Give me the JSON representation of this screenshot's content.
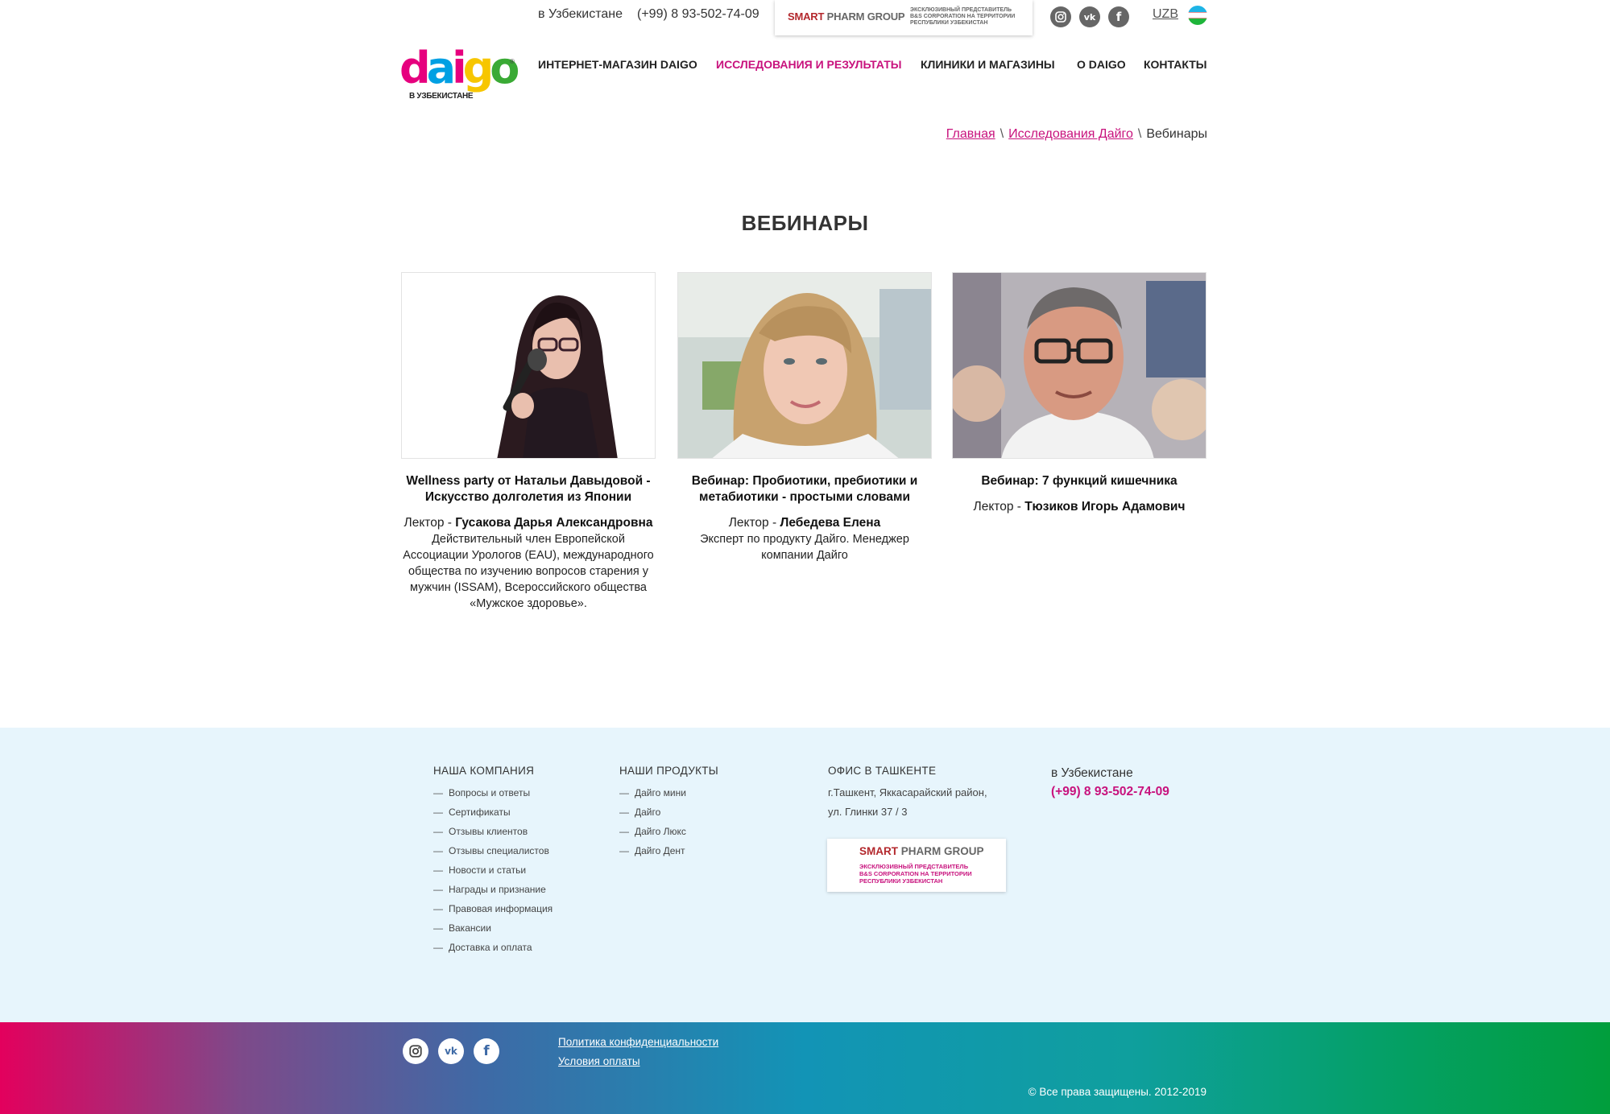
{
  "topbar": {
    "region": "в Узбекистане",
    "phone": "(+99) 8 93-502-74-09",
    "smart_red": "SMART",
    "smart_gray": "PHARM GROUP",
    "smart_sub_1": "ЭКСКЛЮЗИВНЫЙ ПРЕДСТАВИТЕЛЬ",
    "smart_sub_2": "B&S CORPORATION НА ТЕРРИТОРИИ",
    "smart_sub_3": "РЕСПУБЛИКИ УЗБЕКИСТАН",
    "social_icons": [
      "instagram-icon",
      "vk-icon",
      "facebook-icon"
    ],
    "lang": "UZB"
  },
  "logo": {
    "word": "daigo",
    "sub": "В УЗБЕКИСТАНЕ",
    "reg": "®",
    "colors": [
      "#e6007e",
      "#00a0e3",
      "#ffe600",
      "#f7a600",
      "#3aaa35"
    ]
  },
  "nav": [
    {
      "label": "ИНТЕРНЕТ-МАГАЗИН DAIGO"
    },
    {
      "label": "ИССЛЕДОВАНИЯ И РЕЗУЛЬТАТЫ",
      "active": true
    },
    {
      "label": "КЛИНИКИ И МАГАЗИНЫ"
    },
    {
      "label": "О DAIGO"
    },
    {
      "label": "КОНТАКТЫ"
    }
  ],
  "breadcrumb": {
    "home": "Главная",
    "section": "Исследования Дайго",
    "current": "Вебинары",
    "separator": "\\"
  },
  "page_title": "ВЕБИНАРЫ",
  "cards": [
    {
      "title": "Wellness party от Натальи Давыдовой - Искусство долголетия из Японии",
      "lecturer_prefix": "Лектор - ",
      "lecturer_name": "Гусакова Дарья Александровна",
      "description": "Действительный член Европейской Ассоциации Урологов (EAU), международного общества по изучению вопросов старения у мужчин (ISSAM), Всероссийского общества «Мужское здоровье»."
    },
    {
      "title": "Вебинар: Пробиотики, пребиотики и метабиотики - простыми словами",
      "lecturer_prefix": "Лектор - ",
      "lecturer_name": "Лебедева Елена",
      "description": "Эксперт по продукту Дайго. Менеджер компании Дайго"
    },
    {
      "title": "Вебинар: 7 функций кишечника",
      "lecturer_prefix": "Лектор - ",
      "lecturer_name": "Тюзиков Игорь Адамович",
      "description": ""
    }
  ],
  "footer": {
    "company": {
      "heading": "НАША КОМПАНИЯ",
      "items": [
        "Вопросы и ответы",
        "Сертификаты",
        "Отзывы клиентов",
        "Отзывы специалистов",
        "Новости и статьи",
        "Награды и признание",
        "Правовая информация",
        "Вакансии",
        "Доставка и оплата"
      ]
    },
    "products": {
      "heading": "НАШИ ПРОДУКТЫ",
      "items": [
        "Дайго мини",
        "Дайго",
        "Дайго Люкс",
        "Дайго Дент"
      ]
    },
    "office": {
      "heading": "ОФИС В ТАШКЕНТЕ",
      "address_1": "г.Ташкент, Яккасарайский район,",
      "address_2": "ул. Глинки 37 / 3"
    },
    "smart_card": {
      "red": "SMART",
      "gray": "PHARM GROUP",
      "sub_1": "ЭКСКЛЮЗИВНЫЙ ПРЕДСТАВИТЕЛЬ",
      "sub_2": "B&S CORPORATION НА ТЕРРИТОРИИ",
      "sub_3": "РЕСПУБЛИКИ УЗБЕКИСТАН"
    },
    "region": "в Узбекистане",
    "phone": "(+99) 8 93-502-74-09",
    "dash": "—"
  },
  "bottom": {
    "privacy": "Политика конфиденциальности",
    "payment": "Условия оплаты",
    "copyright": "© Все права защищены. 2012-2019"
  },
  "colors": {
    "accent": "#c8127d",
    "footer_bg": "#e7f5fc"
  }
}
